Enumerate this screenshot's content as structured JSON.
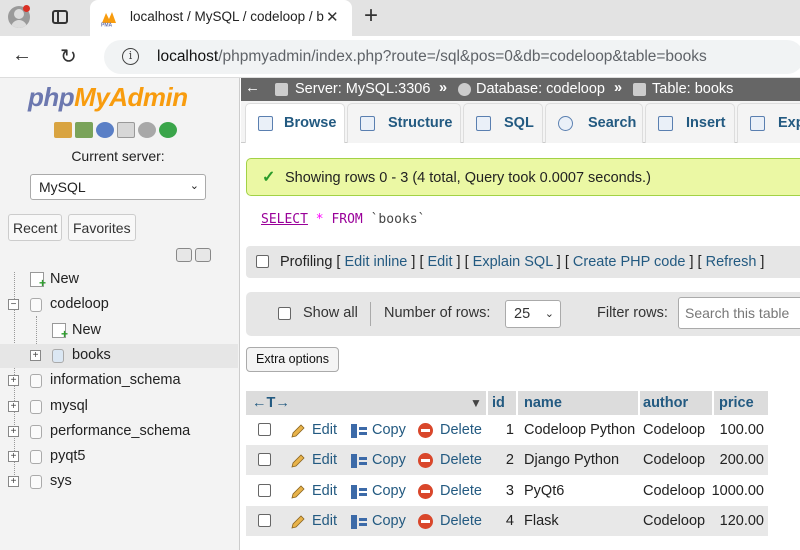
{
  "browser": {
    "tab_title": "localhost / MySQL / codeloop / b",
    "url_host": "localhost",
    "url_path": "/phpmyadmin/index.php?route=/sql&pos=0&db=codeloop&table=books"
  },
  "nav": {
    "logo_php": "php",
    "logo_myadmin": "MyAdmin",
    "current_server_label": "Current server:",
    "server_value": "MySQL",
    "recent_label": "Recent",
    "favorites_label": "Favorites",
    "tree": [
      {
        "label": "New",
        "level": 0,
        "kind": "new",
        "expander": ""
      },
      {
        "label": "codeloop",
        "level": 0,
        "kind": "db",
        "expander": "−"
      },
      {
        "label": "New",
        "level": 1,
        "kind": "new",
        "expander": ""
      },
      {
        "label": "books",
        "level": 1,
        "kind": "table",
        "expander": "+"
      },
      {
        "label": "information_schema",
        "level": 0,
        "kind": "db",
        "expander": "+"
      },
      {
        "label": "mysql",
        "level": 0,
        "kind": "db",
        "expander": "+"
      },
      {
        "label": "performance_schema",
        "level": 0,
        "kind": "db",
        "expander": "+"
      },
      {
        "label": "pyqt5",
        "level": 0,
        "kind": "db",
        "expander": "+"
      },
      {
        "label": "sys",
        "level": 0,
        "kind": "db",
        "expander": "+"
      }
    ]
  },
  "breadcrumb": {
    "server": "Server: MySQL:3306",
    "database": "Database: codeloop",
    "table": "Table: books",
    "separator": "»"
  },
  "tabs": [
    "Browse",
    "Structure",
    "SQL",
    "Search",
    "Insert",
    "Exp"
  ],
  "success_message": "Showing rows 0 - 3 (4 total, Query took 0.0007 seconds.)",
  "sql": {
    "select": "SELECT",
    "star": "*",
    "from": "FROM",
    "table": "`books`"
  },
  "profiling": {
    "label": "Profiling",
    "links": [
      "Edit inline",
      "Edit",
      "Explain SQL",
      "Create PHP code",
      "Refresh"
    ]
  },
  "navigation": {
    "show_all": "Show all",
    "number_of_rows_label": "Number of rows:",
    "rows_value": "25",
    "filter_label": "Filter rows:",
    "filter_placeholder": "Search this table"
  },
  "extra_options": "Extra options",
  "table": {
    "columns": [
      "id",
      "name",
      "author",
      "price"
    ],
    "actions": {
      "edit": "Edit",
      "copy": "Copy",
      "delete": "Delete"
    },
    "rows": [
      {
        "id": "1",
        "name": "Codeloop Python",
        "author": "Codeloop",
        "price": "100.00"
      },
      {
        "id": "2",
        "name": "Django Python",
        "author": "Codeloop",
        "price": "200.00"
      },
      {
        "id": "3",
        "name": "PyQt6",
        "author": "Codeloop",
        "price": "1000.00"
      },
      {
        "id": "4",
        "name": "Flask",
        "author": "Codeloop",
        "price": "120.00"
      }
    ]
  },
  "colors": {
    "accent": "#235a81",
    "success_bg": "#ebf8a4",
    "breadcrumb_bg": "#666666"
  }
}
